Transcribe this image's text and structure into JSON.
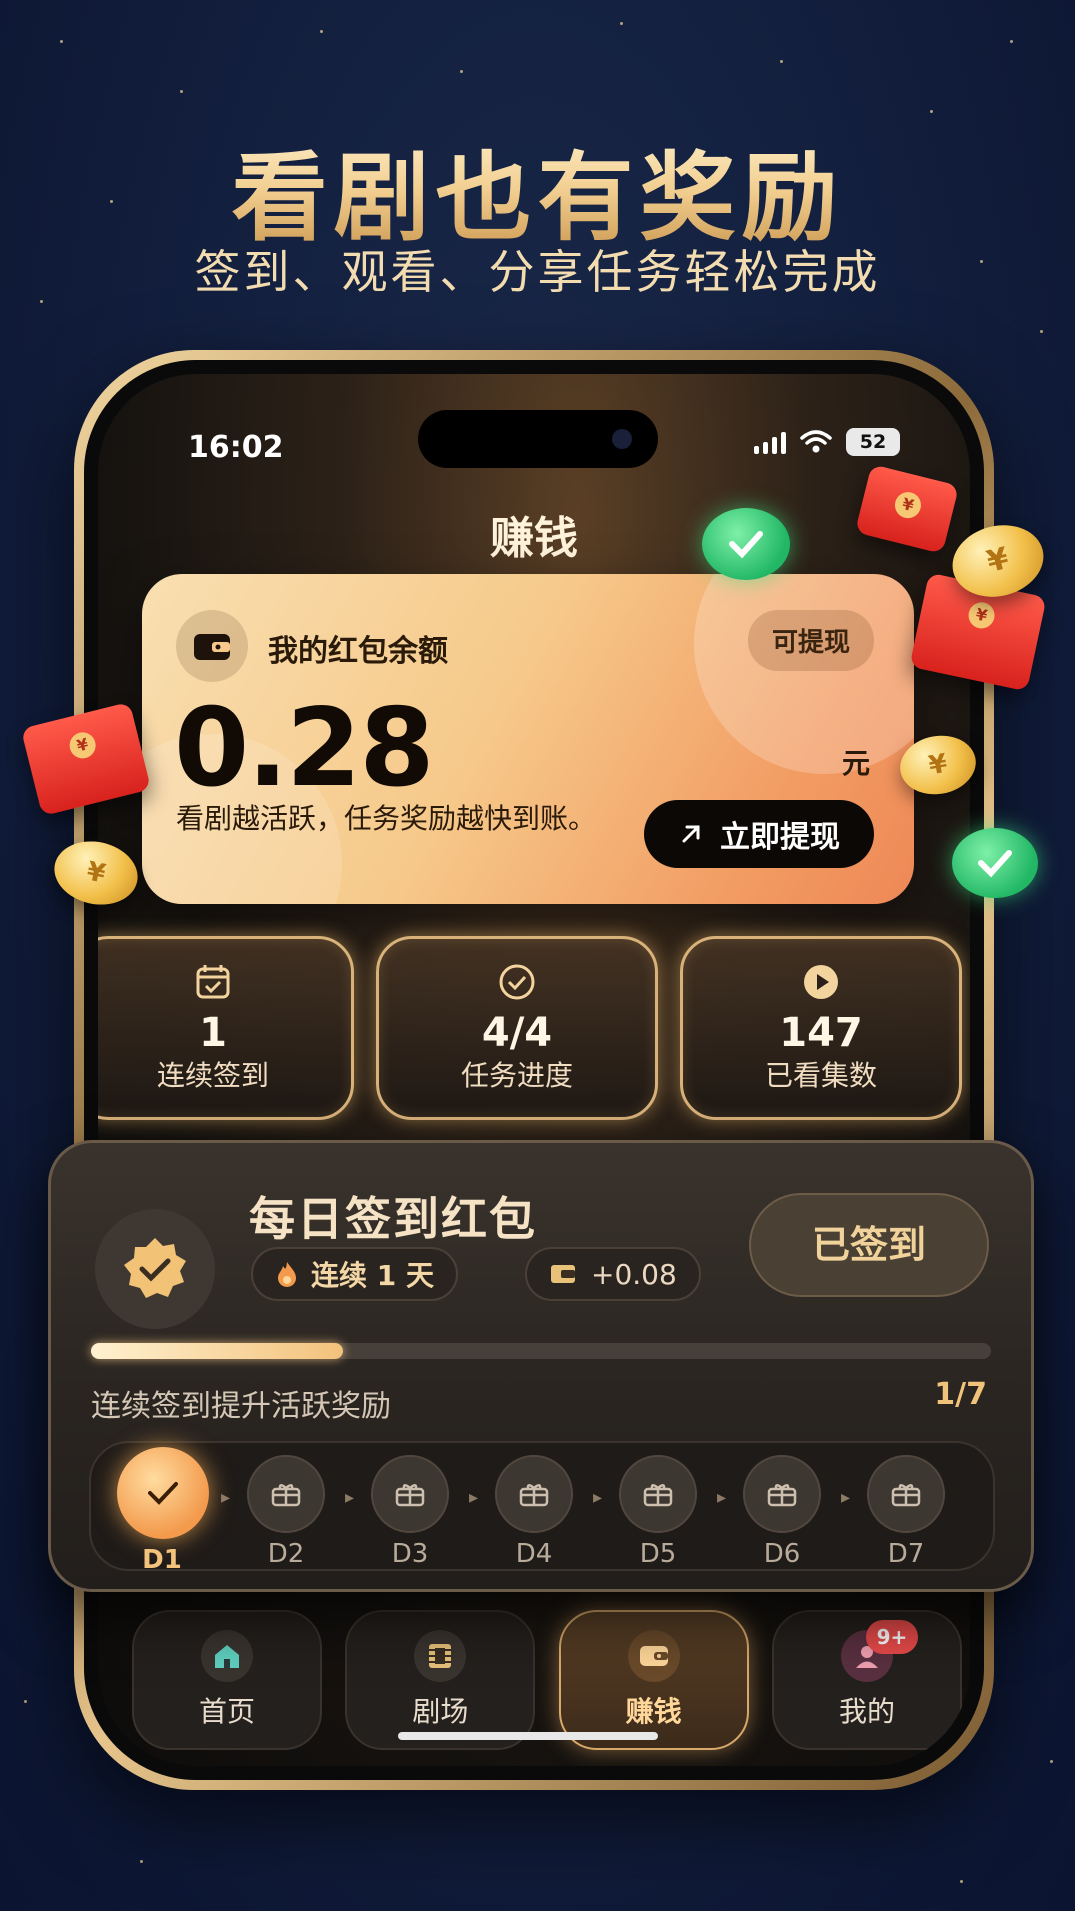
{
  "promo": {
    "title": "看剧也有奖励",
    "subtitle": "签到、观看、分享任务轻松完成"
  },
  "status_bar": {
    "time": "16:02",
    "battery": "52"
  },
  "screen": {
    "title": "赚钱"
  },
  "balance_card": {
    "label": "我的红包余额",
    "withdrawable_tag": "可提现",
    "amount": "0.28",
    "unit": "元",
    "hint": "看剧越活跃，任务奖励越快到账。",
    "withdraw_button": "立即提现"
  },
  "stats": [
    {
      "value": "1",
      "label": "连续签到",
      "icon": "calendar-check-icon"
    },
    {
      "value": "4/4",
      "label": "任务进度",
      "icon": "check-circle-icon"
    },
    {
      "value": "147",
      "label": "已看集数",
      "icon": "play-circle-icon"
    }
  ],
  "checkin": {
    "title": "每日签到红包",
    "streak_chip": "连续 1 天",
    "bonus_chip": "+0.08",
    "signed_button": "已签到",
    "progress_hint": "连续签到提升活跃奖励",
    "progress_count": "1/7",
    "progress": 0.28,
    "days": [
      "D1",
      "D2",
      "D3",
      "D4",
      "D5",
      "D6",
      "D7"
    ],
    "done_days": 1
  },
  "nav": {
    "items": [
      {
        "label": "首页",
        "icon": "home-icon"
      },
      {
        "label": "剧场",
        "icon": "film-icon"
      },
      {
        "label": "赚钱",
        "icon": "wallet-icon",
        "active": true
      },
      {
        "label": "我的",
        "icon": "profile-icon",
        "badge": "9+"
      }
    ]
  },
  "colors": {
    "gold": "#f2cf91",
    "accent_orange": "#f29c63",
    "navy": "#142140"
  }
}
